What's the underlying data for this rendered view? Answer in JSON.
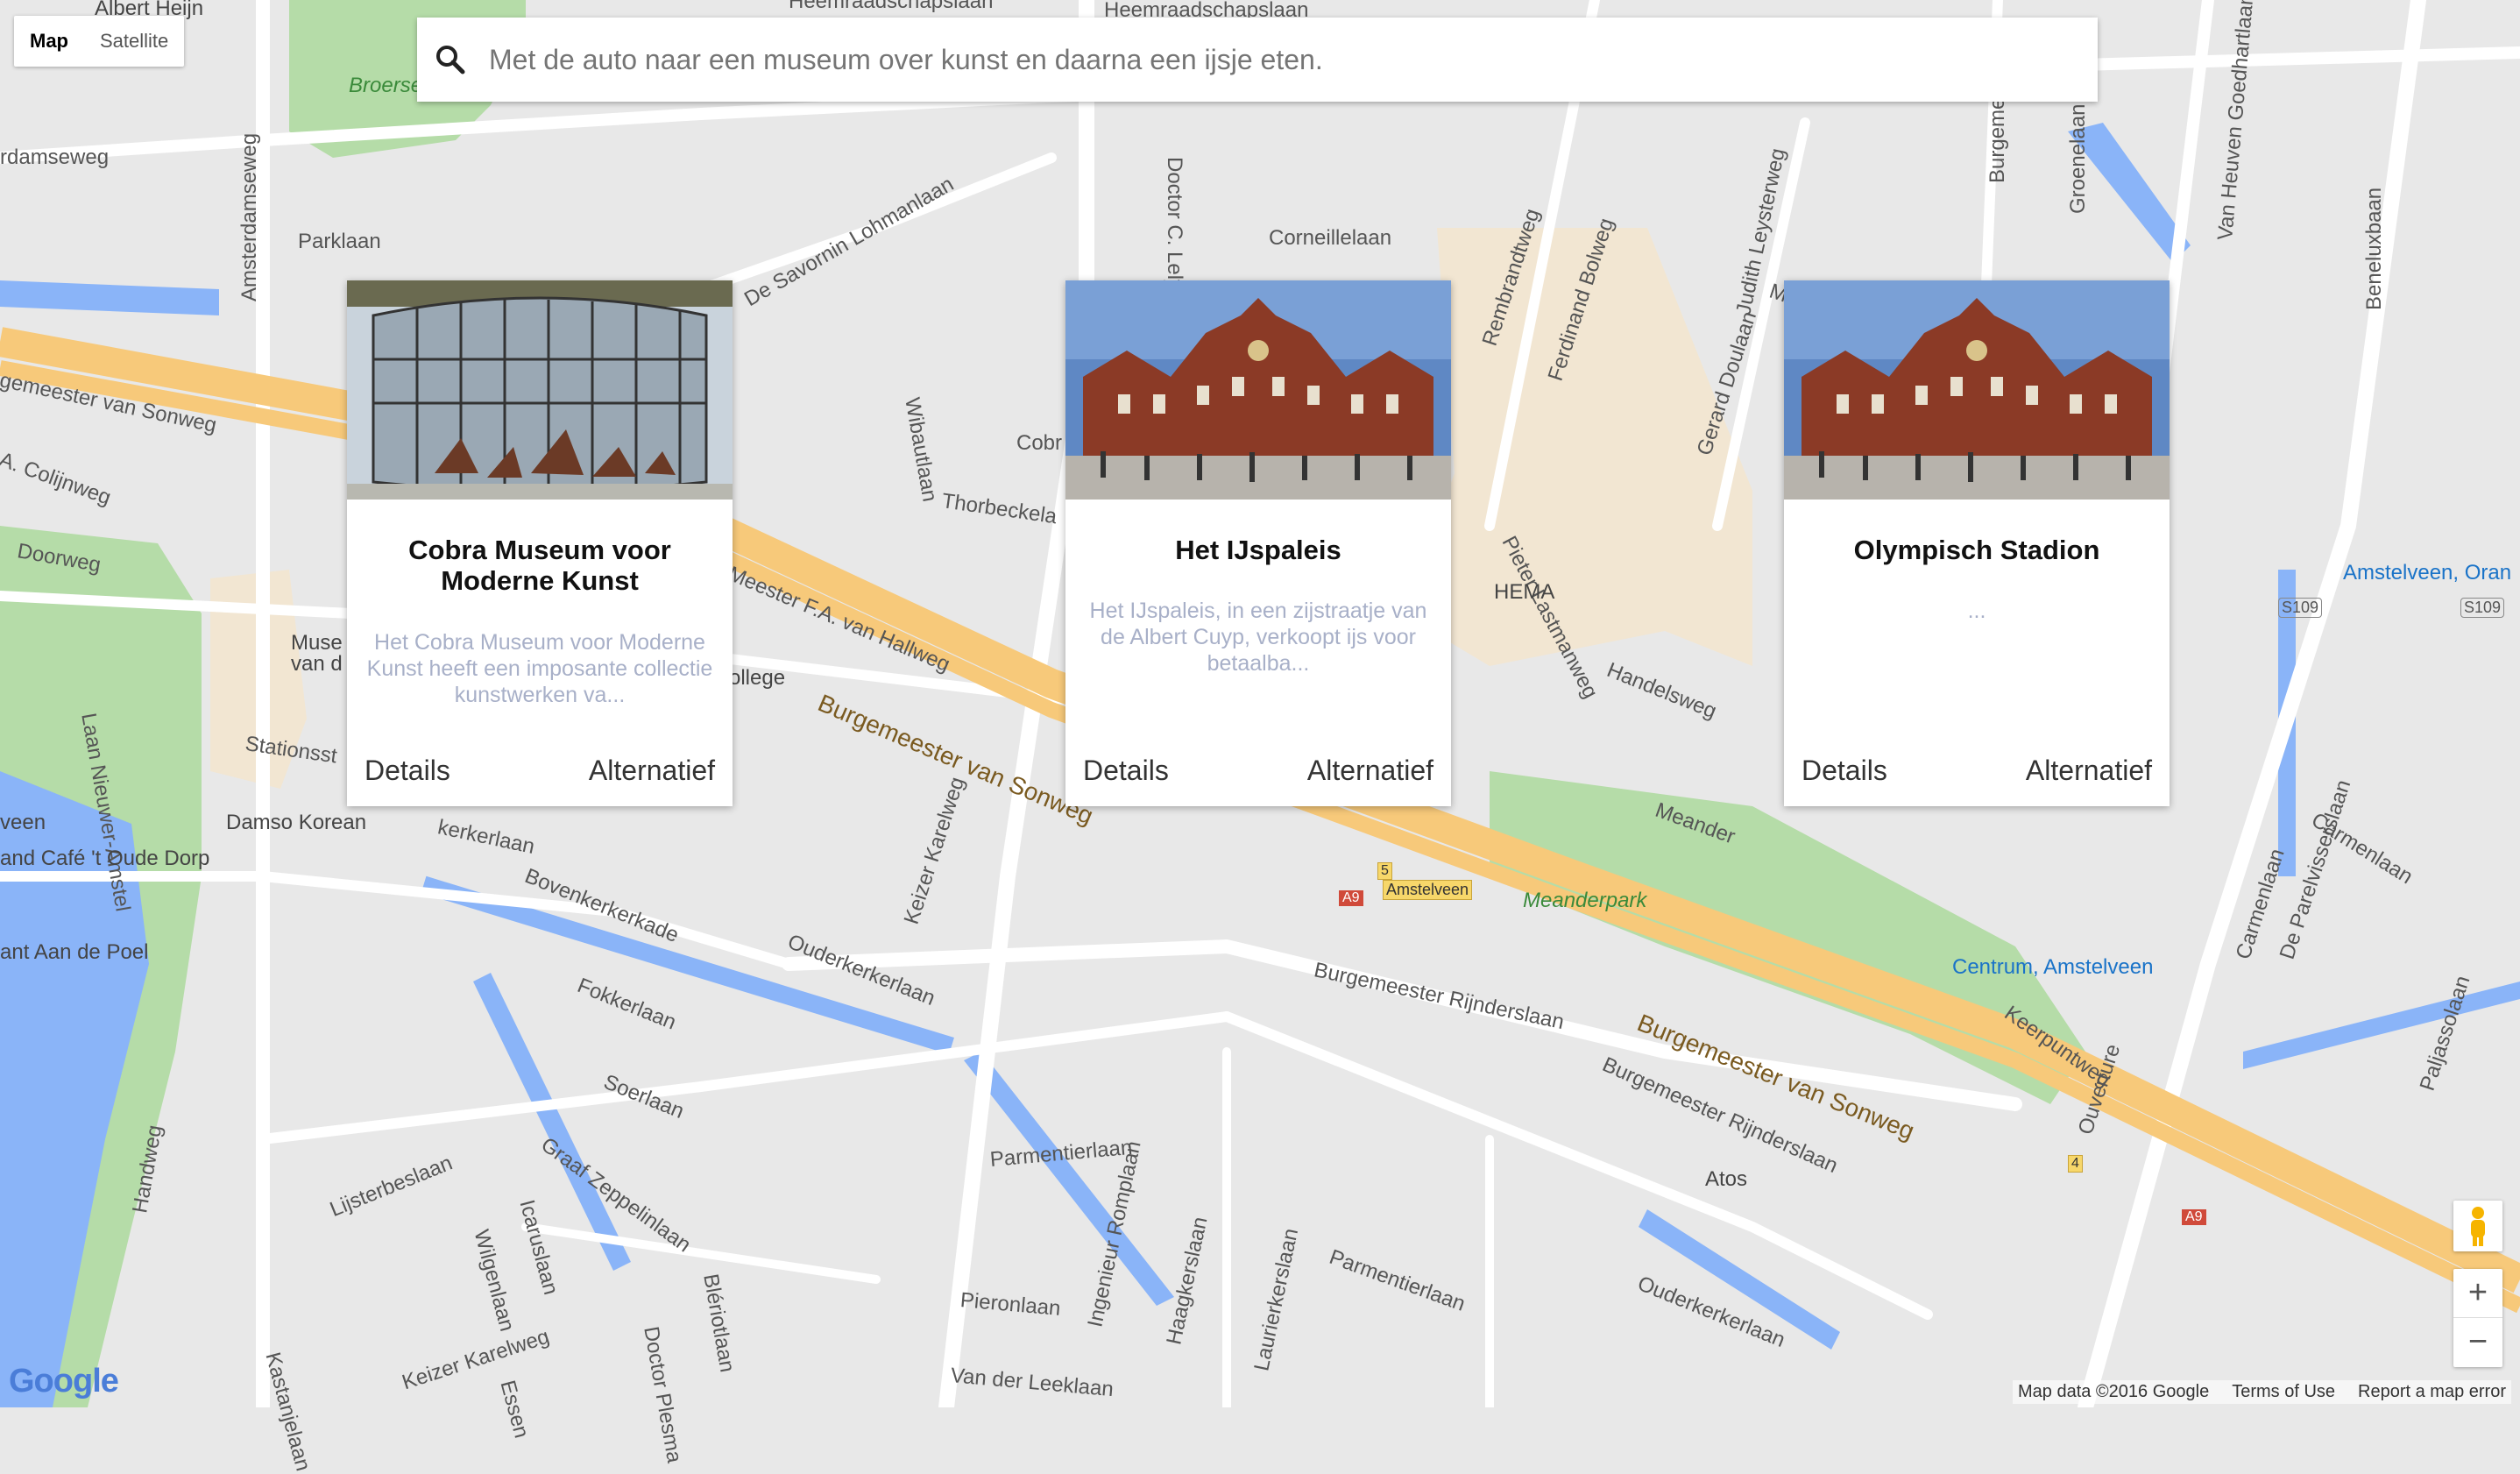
{
  "map_type": {
    "options": [
      "Map",
      "Satellite"
    ],
    "selected": "Map"
  },
  "search": {
    "value": "",
    "placeholder": "Met de auto naar een museum over kunst en daarna een ijsje eten."
  },
  "cards": [
    {
      "title": "Cobra Museum voor Moderne Kunst",
      "description": "Het Cobra Museum voor Moderne Kunst heeft een imposante collectie kunstwerken va...",
      "details_label": "Details",
      "alt_label": "Alternatief"
    },
    {
      "title": "Het IJspaleis",
      "description": "Het IJspaleis, in een zijstraatje van de Albert Cuyp, verkoopt ijs voor betaalba...",
      "details_label": "Details",
      "alt_label": "Alternatief"
    },
    {
      "title": "Olympisch Stadion",
      "description": "...",
      "details_label": "Details",
      "alt_label": "Alternatief"
    }
  ],
  "map_labels": {
    "albert_heijn": "Albert Heijn",
    "heemraadschapslaan": "Heemraadschapslaan",
    "broerse": "Broerse",
    "damseweg": "rdamseweg",
    "amsterdamseweg": "Amsterdamseweg",
    "parklaan": "Parklaan",
    "de_savornin": "De Savornin Lohmanlaan",
    "doctor_c_lely": "Doctor C. Lely",
    "corneillelaan": "Corneillelaan",
    "rembrandtweg": "Rembrandtweg",
    "ferdinand_bolweg": "Ferdinand Bolweg",
    "gerard_doulaan": "Gerard Doulaan",
    "judith_leysterweg": "Judith Leysterweg",
    "burgemeester": "Burgemeester",
    "groenelaan": "Groenelaan",
    "van_heuven": "Van Heuven Goedhartlaan",
    "beneluxbaan": "Beneluxbaan",
    "meesl": "Mees",
    "gemeester_sonweg": "gemeester van Sonweg",
    "colijnweg": "A. Colijnweg",
    "wibautlaan": "Wibautlaan",
    "cobr": "Cobr",
    "thorbeckela": "Thorbeckela",
    "pieter_lastmanweg": "Pieter Lastmanweg",
    "hema": "HEMA",
    "doorweg": "Doorweg",
    "laan_nieuwer_amstel": "Laan Nieuwer-Amstel",
    "muse": "Muse",
    "van_d": "van d",
    "stationsst": "Stationsst",
    "ollege": "ollege",
    "meester_fa": "Meester F.A. van Hallweg",
    "burgemeester_sonweg": "Burgemeester van Sonweg",
    "handelsweg": "Handelsweg",
    "amstelveen_oran": "Amstelveen, Oran",
    "s109": "S109",
    "veen": "veen",
    "damso_korean": "Damso Korean",
    "cafe_oude_dorp": "and Café 't Oude Dorp",
    "kerkerlaan": "kerkerlaan",
    "meander": "Meander",
    "carmenlaan": "Carmenlaan",
    "bovenkerkerkade": "Bovenkerkerkade",
    "amstelveen_sign": "Amstelveen",
    "a9": "A9",
    "n5": "5",
    "meanderpark": "Meanderpark",
    "keizer_karelweg": "Keizer Karelweg",
    "ant_aan_de_poel": "ant Aan de Poel",
    "ouderkerkerlaan": "Ouderkerkerlaan",
    "burgemeester_rijnderslaan": "Burgemeester Rijnderslaan",
    "centrum_amstelveen": "Centrum, Amstelveen",
    "keerpuntweg": "Keerpuntweg",
    "carmenlaan2": "Carmenlaan",
    "de_parelvisserslaan": "De Parelvisserslaan",
    "paljassolaan": "Paljassolaan",
    "fokkerlaan": "Fokkerlaan",
    "soerlaan": "Soerlaan",
    "graaf_zeppelinlaan": "Graaf Zeppelinlaan",
    "lijsterbeslaan": "Lijsterbeslaan",
    "handweg": "Handweg",
    "wilgenlaan": "Wilgenlaan",
    "icaruslaan": "Icaruslaan",
    "bleriotlaan": "Blériotlaan",
    "doctor_plesman": "Doctor Plesma",
    "kastanjelaan": "Kastanjelaan",
    "keizer_karelweg2": "Keizer Karelweg",
    "essen": "Essen",
    "parmentierlaan": "Parmentierlaan",
    "ingenieur_romplaan": "Ingenieur Romplaan",
    "haagkerslaan": "Haagkerslaan",
    "laurierkerslaan": "Laurierkerslaan",
    "pieronlaan": "Pieronlaan",
    "van_der_leeklaan": "Van der Leeklaan",
    "parmentierlaan2": "Parmentierlaan",
    "atos": "Atos",
    "ouverture": "Ouverture",
    "n4": "4",
    "ouderkerkerlaan2": "Ouderkerkerlaan"
  },
  "zoom_controls": {
    "plus": "+",
    "minus": "−"
  },
  "footer": {
    "map_data": "Map data ©2016 Google",
    "terms": "Terms of Use",
    "report": "Report a map error"
  },
  "google_logo": "Google",
  "colors": {
    "road": "#ffffff",
    "highway": "#f7c97a",
    "water": "#8ab4f8",
    "park": "#b5dca8",
    "background": "#e8e8e8",
    "transit": "#1a73c8"
  }
}
